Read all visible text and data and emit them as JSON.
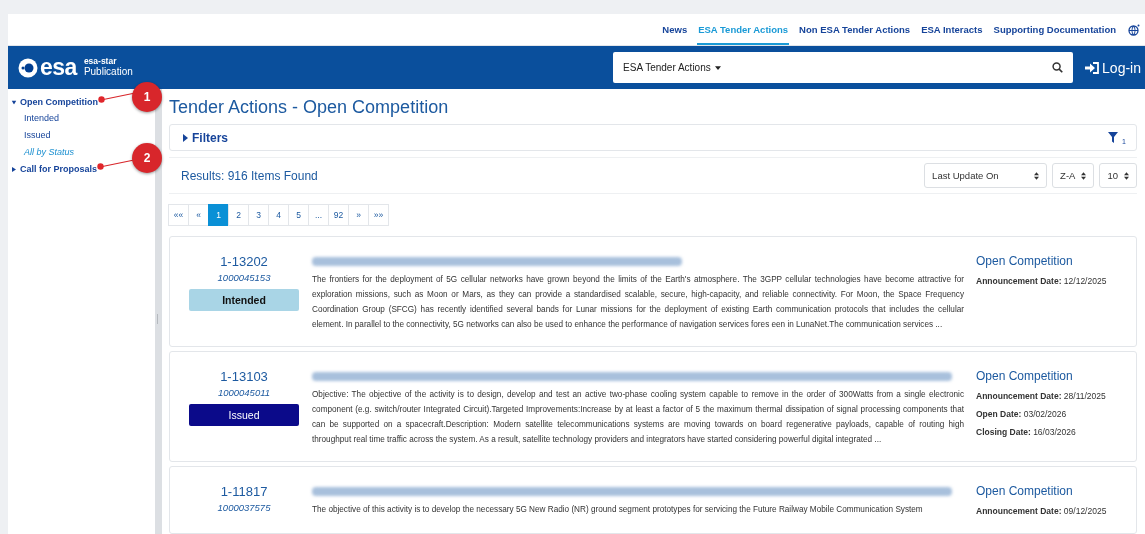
{
  "top_nav": [
    {
      "label": "News",
      "selected": false
    },
    {
      "label": "ESA Tender Actions",
      "selected": true
    },
    {
      "label": "Non ESA Tender Actions",
      "selected": false
    },
    {
      "label": "ESA Interacts",
      "selected": false
    },
    {
      "label": "Supporting Documentation",
      "selected": false
    }
  ],
  "header": {
    "logo": {
      "name": "esa",
      "product": "esa-star",
      "subtitle": "Publication"
    },
    "search": {
      "value": "ESA Tender Actions"
    },
    "login": "Log-in"
  },
  "sidebar": {
    "items": [
      {
        "label": "Open Competition",
        "expanded": true,
        "marker": "1",
        "children": [
          {
            "label": "Intended",
            "selected": false
          },
          {
            "label": "Issued",
            "selected": false
          },
          {
            "label": "All by Status",
            "selected": true
          }
        ]
      },
      {
        "label": "Call for Proposals",
        "expanded": false,
        "marker": "2"
      }
    ]
  },
  "page_title": "Tender Actions - Open Competition",
  "filters": {
    "label": "Filters",
    "count": "1"
  },
  "results": "Results: 916 Items Found",
  "sort_selects": [
    "Last Update On",
    "Z-A",
    "10"
  ],
  "pagination": [
    {
      "label": "««",
      "selected": false
    },
    {
      "label": "«",
      "selected": false
    },
    {
      "label": "1",
      "selected": true
    },
    {
      "label": "2",
      "selected": false
    },
    {
      "label": "3",
      "selected": false
    },
    {
      "label": "4",
      "selected": false
    },
    {
      "label": "5",
      "selected": false
    },
    {
      "label": "...",
      "selected": false
    },
    {
      "label": "92",
      "selected": false
    },
    {
      "label": "»",
      "selected": false
    },
    {
      "label": "»»",
      "selected": false
    }
  ],
  "cards": [
    {
      "id": "1-13202",
      "reference": "1000045153",
      "status": {
        "label": "Intended",
        "kind": "intended"
      },
      "description": "The frontiers for the deployment of 5G cellular networks have grown beyond the limits of the Earth's atmosphere. The 3GPP cellular technologies have become attractive for exploration missions, such as Moon or Mars, as they can provide a standardised scalable, secure, high-capacity, and reliable connectivity. For Moon, the Space Frequency Coordination Group (SFCG) has recently identified several bands for Lunar missions for the deployment of existing Earth communication protocols that includes the cellular element. In parallel to the connectivity, 5G networks can also be used to enhance the performance of navigation services fores een in LunaNet.The communication services ...",
      "category": "Open Competition",
      "dates": [
        {
          "label": "Announcement Date:",
          "value": "12/12/2025"
        }
      ]
    },
    {
      "id": "1-13103",
      "reference": "1000045011",
      "status": {
        "label": "Issued",
        "kind": "issued"
      },
      "description": "Objective: The objective of the activity is to design, develop and test an active two-phase cooling system capable to remove in the order of 300Watts from a single electronic component (e.g. switch/router Integrated Circuit).Targeted Improvements:Increase by at least a factor of 5 the maximum thermal dissipation of signal processing components that can be supported on a spacecraft.Description: Modern satellite telecommunications systems are moving towards on board regenerative payloads, capable of routing high throughput real time traffic across the system. As a result, satellite technology providers and integrators have started considering powerful digital integrated ...",
      "category": "Open Competition",
      "dates": [
        {
          "label": "Announcement Date:",
          "value": "28/11/2025"
        },
        {
          "label": "Open Date:",
          "value": "03/02/2026"
        },
        {
          "label": "Closing Date:",
          "value": "16/03/2026"
        }
      ]
    },
    {
      "id": "1-11817",
      "reference": "1000037575",
      "description": "The objective of this activity is to develop the necessary 5G New Radio (NR) ground segment prototypes for servicing the Future Railway Mobile Communication System",
      "category": "Open Competition",
      "dates": [
        {
          "label": "Announcement Date:",
          "value": "09/12/2025"
        }
      ]
    }
  ]
}
